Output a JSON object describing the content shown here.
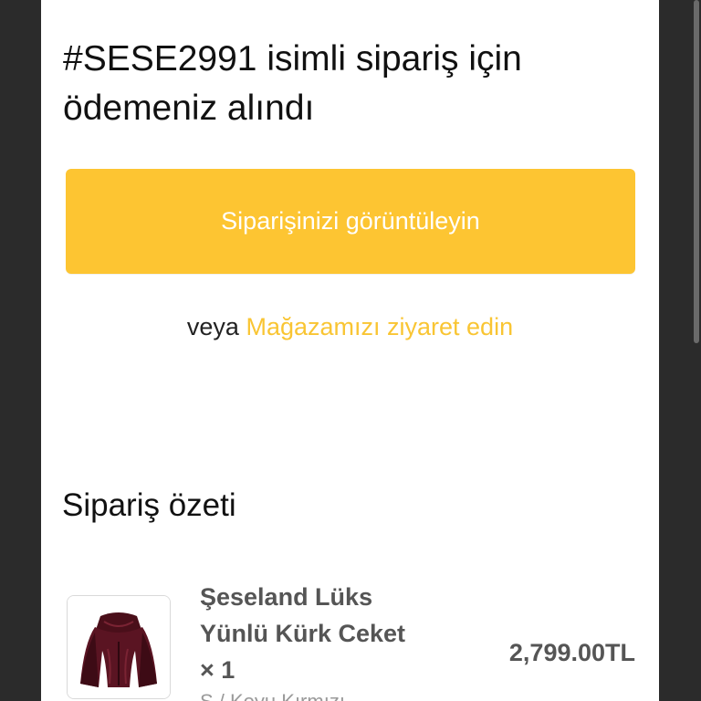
{
  "order": {
    "title": "#SESE2991 isimli sipariş için ödemeniz alındı",
    "view_order_label": "Siparişinizi görüntüleyin",
    "or_label": "veya",
    "visit_store_label": "Mağazamızı ziyaret edin"
  },
  "summary": {
    "title": "Sipariş özeti",
    "items": [
      {
        "name": "Şeseland Lüks Yünlü Kürk Ceket × 1",
        "variant": "S / Koyu Kırmızı",
        "price": "2,799.00TL",
        "image_icon": "fur-jacket-image"
      }
    ]
  },
  "colors": {
    "accent": "#fdc532",
    "link": "#f9c533",
    "page_background": "#ffffff",
    "outer_background": "#2b2b2b"
  }
}
